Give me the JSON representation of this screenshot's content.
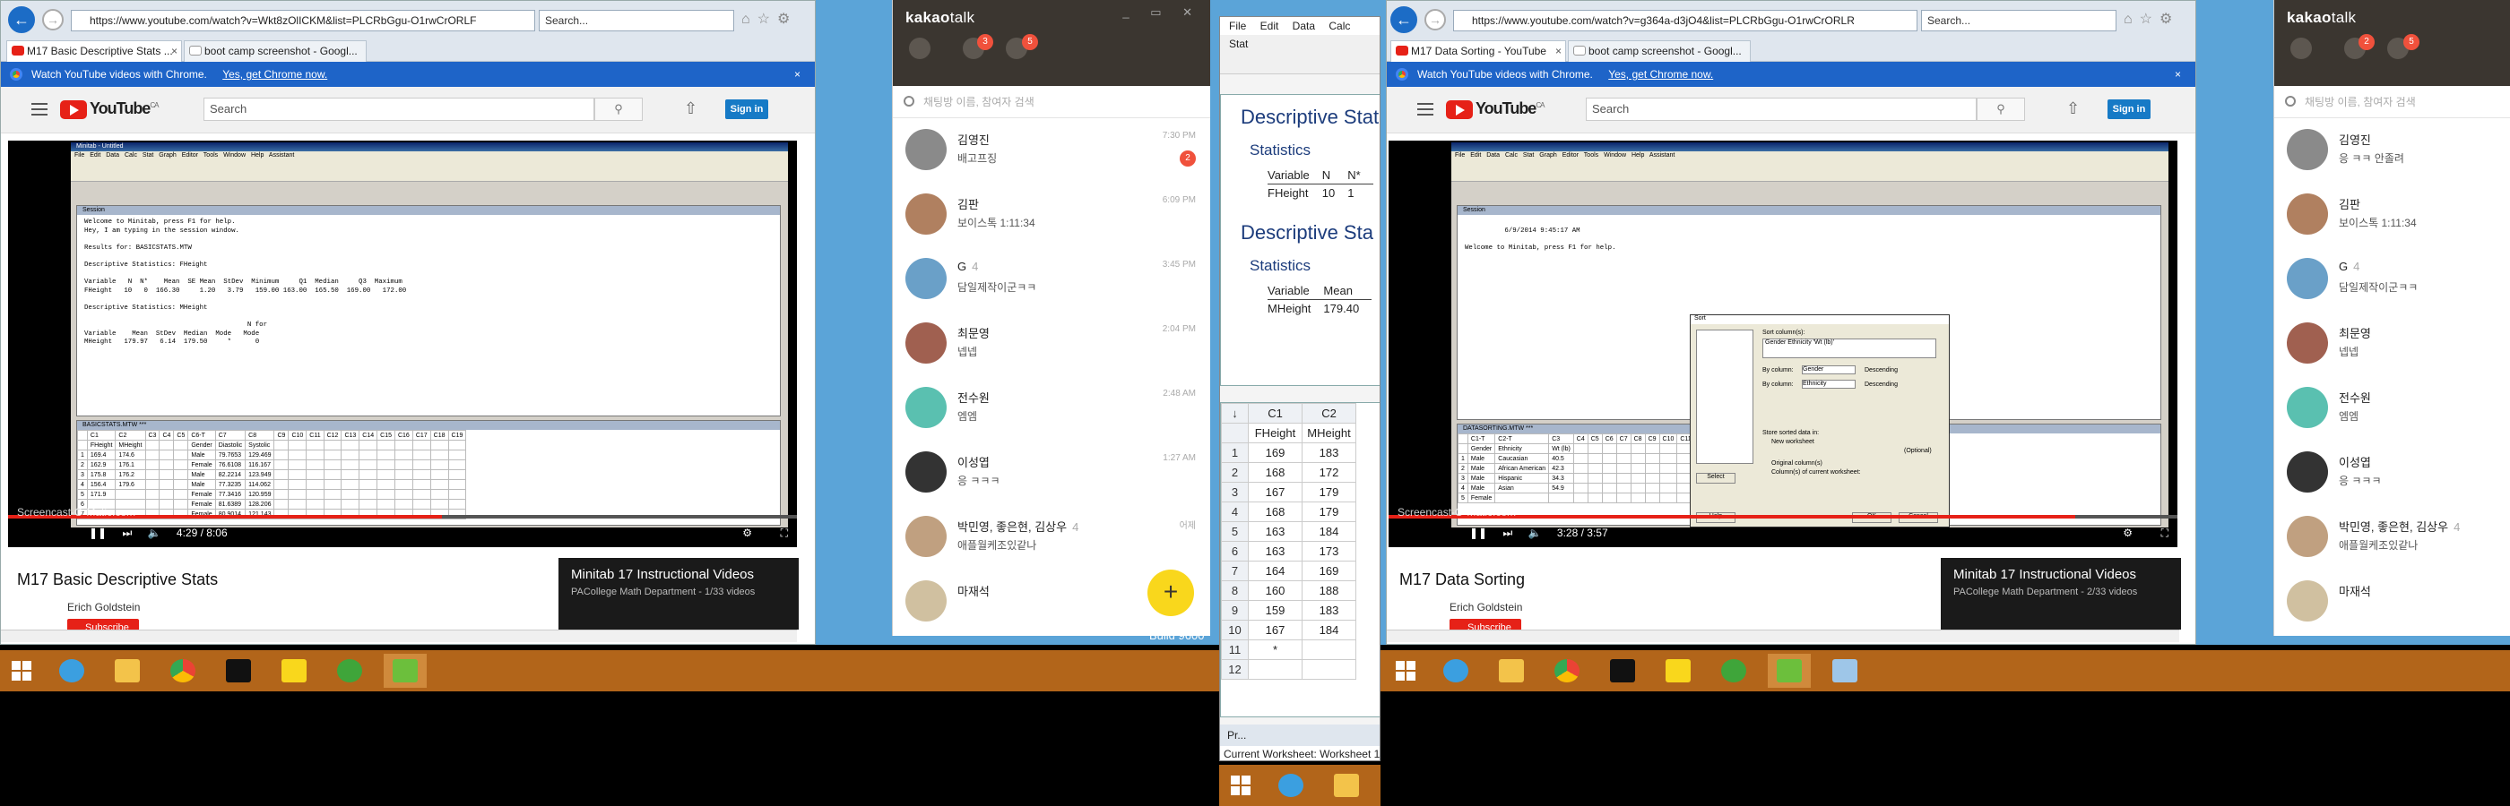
{
  "left_ie": {
    "url": "https://www.youtube.com/watch?v=Wkt8zOlICKM&list=PLCRbGgu-O1rwCrORLF",
    "search_placeholder": "Search...",
    "tabs": [
      "M17 Basic Descriptive Stats ...",
      "boot camp screenshot - Googl..."
    ],
    "chrome_banner": "Watch YouTube videos with Chrome.",
    "chrome_link": "Yes, get Chrome now.",
    "yt_search": "Search",
    "signin": "Sign in",
    "logo": "YouTube",
    "logo_sup": "CA",
    "video_time": "4:29 / 8:06",
    "progress": 0.55,
    "video_title": "M17 Basic Descriptive Stats",
    "channel": "Erich Goldstein",
    "subscribe": "Subscribe",
    "playlist_title": "Minitab 17 Instructional Videos",
    "playlist_sub": "PACollege Math Department - 1/33 videos",
    "watermark": "Screencast-O-Matic.com",
    "minitab": {
      "title": "Minitab - Untitled",
      "menu": "File Edit Data Calc Stat Graph Editor Tools Window Help Assistant",
      "session_title": "Session",
      "session_text": "Welcome to Minitab, press F1 for help.\nHey, I am typing in the session window.\n\nResults for: BASICSTATS.MTW\n\nDescriptive Statistics: FHeight\n\nVariable   N  N*    Mean  SE Mean  StDev  Minimum     Q1  Median     Q3  Maximum\nFHeight   10   0  166.30     1.20   3.79   159.00 163.00  165.50  169.00   172.00\n\nDescriptive Statistics: MHeight\n\n                                         N for\nVariable    Mean  StDev  Median  Mode   Mode\nMHeight   179.97   6.14  179.50     *      0",
      "ws_title": "BASICSTATS.MTW ***",
      "ws_cols": [
        "",
        "C1",
        "C2",
        "C3",
        "C4",
        "C5",
        "C6-T",
        "C7",
        "C8",
        "C9",
        "C10",
        "C11",
        "C12",
        "C13",
        "C14",
        "C15",
        "C16",
        "C17",
        "C18",
        "C19"
      ],
      "ws_names": [
        "",
        "FHeight",
        "MHeight",
        "",
        "",
        "",
        "Gender",
        "Diastolic",
        "Systolic",
        "",
        "",
        "",
        "",
        "",
        "",
        "",
        "",
        "",
        "",
        ""
      ],
      "ws_rows": [
        [
          "1",
          "169.4",
          "174.6",
          "",
          "",
          "",
          "Male",
          "79.7653",
          "129.469"
        ],
        [
          "2",
          "162.9",
          "176.1",
          "",
          "",
          "",
          "Female",
          "76.6108",
          "116.167"
        ],
        [
          "3",
          "175.8",
          "176.2",
          "",
          "",
          "",
          "Male",
          "82.2214",
          "123.949"
        ],
        [
          "4",
          "156.4",
          "179.6",
          "",
          "",
          "",
          "Male",
          "77.3235",
          "114.062"
        ],
        [
          "5",
          "171.9",
          "",
          "",
          "",
          "",
          "Female",
          "77.3416",
          "120.959"
        ],
        [
          "6",
          "",
          "",
          "",
          "",
          "",
          "Female",
          "81.6389",
          "128.206"
        ],
        [
          "7",
          "",
          "",
          "",
          "",
          "",
          "Female",
          "80.9014",
          "121.143"
        ]
      ]
    }
  },
  "kakao_left": {
    "brand": "kakao",
    "brand_bold": "talk",
    "badges": [
      "3",
      "5"
    ],
    "search_placeholder": "채팅방 이름, 참여자 검색",
    "chats": [
      {
        "name": "김영진",
        "msg": "배고프징",
        "time": "7:30 PM",
        "unread": "2",
        "count": ""
      },
      {
        "name": "김판",
        "msg": "보이스톡 1:11:34",
        "time": "6:09 PM",
        "unread": "",
        "count": ""
      },
      {
        "name": "G",
        "msg": "담일제작이군ㅋㅋ",
        "time": "3:45 PM",
        "unread": "",
        "count": "4"
      },
      {
        "name": "최문영",
        "msg": "넵넵",
        "time": "2:04 PM",
        "unread": "",
        "count": ""
      },
      {
        "name": "전수원",
        "msg": "엠엠",
        "time": "2:48 AM",
        "unread": "",
        "count": ""
      },
      {
        "name": "이성엽",
        "msg": "응 ㅋㅋㅋ",
        "time": "1:27 AM",
        "unread": "",
        "count": ""
      },
      {
        "name": "박민영, 좋은현, 김상우",
        "msg": "애플월케조있같나",
        "time": "어제",
        "unread": "",
        "count": "4"
      },
      {
        "name": "마재석",
        "msg": "",
        "time": "",
        "unread": "",
        "count": ""
      }
    ],
    "fab": "+"
  },
  "minitab_mid": {
    "menu": "File Edit Data Calc Stat",
    "out": {
      "h1": "Descriptive Stat",
      "stats1": "Statistics",
      "cols1": [
        "Variable",
        "N",
        "N*"
      ],
      "row1": [
        "FHeight",
        "10",
        "1"
      ],
      "h2": "Descriptive Sta",
      "stats2": "Statistics",
      "cols2": [
        "Variable",
        "Mean"
      ],
      "row2": [
        "MHeight",
        "179.40"
      ]
    },
    "grid_cols": [
      "C1",
      "C2"
    ],
    "grid_names": [
      "FHeight",
      "MHeight"
    ],
    "grid_rows": [
      [
        "1",
        "169",
        "183"
      ],
      [
        "2",
        "168",
        "172"
      ],
      [
        "3",
        "167",
        "179"
      ],
      [
        "4",
        "168",
        "179"
      ],
      [
        "5",
        "163",
        "184"
      ],
      [
        "6",
        "163",
        "173"
      ],
      [
        "7",
        "164",
        "169"
      ],
      [
        "8",
        "160",
        "188"
      ],
      [
        "9",
        "159",
        "183"
      ],
      [
        "10",
        "167",
        "184"
      ],
      [
        "11",
        "*",
        ""
      ],
      [
        "12",
        "",
        ""
      ]
    ],
    "proj_label": "Pr...",
    "status": "Current Worksheet: Worksheet 1"
  },
  "right_ie": {
    "url": "https://www.youtube.com/watch?v=g364a-d3jO4&list=PLCRbGgu-O1rwCrORLR",
    "search_placeholder": "Search...",
    "tabs": [
      "M17 Data Sorting - YouTube",
      "boot camp screenshot - Googl..."
    ],
    "chrome_banner": "Watch YouTube videos with Chrome.",
    "chrome_link": "Yes, get Chrome now.",
    "yt_search": "Search",
    "signin": "Sign in",
    "logo": "YouTube",
    "logo_sup": "CA",
    "video_time": "3:28 / 3:57",
    "progress": 0.87,
    "video_title": "M17 Data Sorting",
    "channel": "Erich Goldstein",
    "subscribe": "Subscribe",
    "playlist_title": "Minitab 17 Instructional Videos",
    "playlist_sub": "PACollege Math Department - 2/33 videos",
    "watermark": "Screencast-O-Matic.com",
    "minitab": {
      "session_title": "Session",
      "session_text": "\n          6/9/2014 9:45:17 AM\n\nWelcome to Minitab, press F1 for help.",
      "ws_title": "DATASORTING.MTW ***",
      "ws_cols": [
        "",
        "C1-T",
        "C2-T",
        "C3",
        "C4",
        "C5",
        "C6",
        "C7",
        "C8",
        "C9",
        "C10",
        "C11",
        "C12",
        "C13",
        "C14",
        "C15",
        "C16",
        "C17",
        "C18"
      ],
      "ws_names": [
        "",
        "Gender",
        "Ethnicity",
        "Wt (lb)",
        "",
        "",
        "",
        "",
        "",
        "",
        "",
        "",
        "",
        "",
        "",
        "",
        "",
        "",
        ""
      ],
      "ws_rows": [
        [
          "1",
          "Male",
          "Caucasian",
          "40.5"
        ],
        [
          "2",
          "Male",
          "African American",
          "42.3"
        ],
        [
          "3",
          "Male",
          "Hispanic",
          "34.3"
        ],
        [
          "4",
          "Male",
          "Asian",
          "54.9"
        ],
        [
          "5",
          "Female",
          "",
          ""
        ]
      ],
      "dialog": {
        "title": "Sort",
        "cols_label": "Sort column(s):",
        "cols_value": "Gender Ethnicity 'Wt (lb)'",
        "by_label": "By column:",
        "by1": "Gender",
        "by2": "Ethnicity",
        "desc": "Descending",
        "store": "Store sorted data in:",
        "new_ws": "New worksheet",
        "name_opt": "(Optional)",
        "orig": "Original column(s)",
        "cur": "Column(s) of current worksheet:",
        "select": "Select",
        "help": "Help",
        "ok": "OK",
        "cancel": "Cancel"
      }
    }
  },
  "kakao_right": {
    "brand": "kakao",
    "brand_bold": "talk",
    "badges": [
      "2",
      "5"
    ],
    "search_placeholder": "채팅방 이름, 참여자 검색",
    "chats": [
      {
        "name": "김영진",
        "msg": "응 ㅋㅋ 안졸려",
        "count": ""
      },
      {
        "name": "김판",
        "msg": "보이스톡 1:11:34",
        "count": ""
      },
      {
        "name": "G",
        "msg": "담일제작이군ㅋㅋ",
        "count": "4"
      },
      {
        "name": "최문영",
        "msg": "넵넵",
        "count": ""
      },
      {
        "name": "전수원",
        "msg": "엠엠",
        "count": ""
      },
      {
        "name": "이성엽",
        "msg": "응 ㅋㅋㅋ",
        "count": ""
      },
      {
        "name": "박민영, 좋은현, 김상우",
        "msg": "애플월케조있같나",
        "count": "4"
      },
      {
        "name": "마재석",
        "msg": "",
        "count": ""
      }
    ]
  },
  "taskbar": {
    "build": "Build 9600"
  }
}
